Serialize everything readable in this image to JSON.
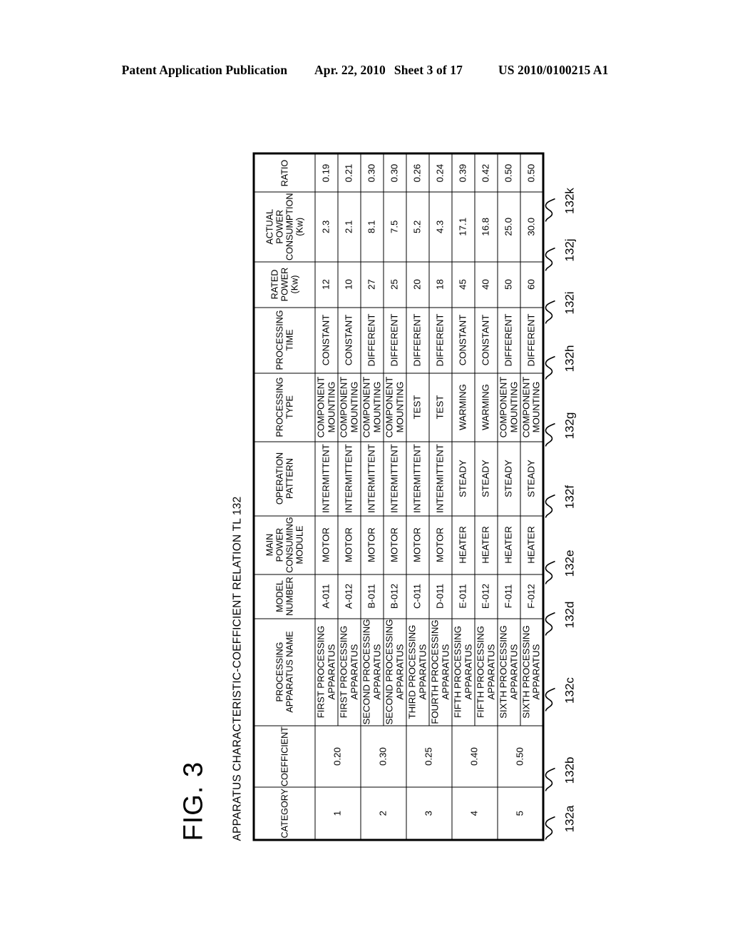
{
  "header": {
    "publication": "Patent Application Publication",
    "date": "Apr. 22, 2010",
    "sheet": "Sheet 3 of 17",
    "patent_number": "US 2010/0100215 A1"
  },
  "figure": {
    "label": "FIG. 3",
    "caption": "APPARATUS CHARACTERISTIC-COEFFICIENT RELATION TL 132"
  },
  "table": {
    "columns": [
      {
        "ref": "132a",
        "header": "CATEGORY"
      },
      {
        "ref": "132b",
        "header": "COEFFICIENT"
      },
      {
        "ref": "132c",
        "header": "PROCESSING APPARATUS NAME"
      },
      {
        "ref": "132d",
        "header": "MODEL NUMBER"
      },
      {
        "ref": "132e",
        "header": "MAIN POWER CONSUMING MODULE"
      },
      {
        "ref": "132f",
        "header": "OPERATION PATTERN"
      },
      {
        "ref": "132g",
        "header": "PROCESSING TYPE"
      },
      {
        "ref": "132h",
        "header": "PROCESSING TIME"
      },
      {
        "ref": "132i",
        "header": "RATED POWER (Kw)"
      },
      {
        "ref": "132j",
        "header": "ACTUAL POWER CONSUMPTION (Kw)"
      },
      {
        "ref": "132k",
        "header": "RATIO"
      }
    ],
    "headers": {
      "category": "CATEGORY",
      "coefficient": "COEFFICIENT",
      "apparatus_name": "PROCESSING APPARATUS NAME",
      "model_number": "MODEL NUMBER",
      "module": "MAIN POWER CONSUMING MODULE",
      "operation_pattern": "OPERATION PATTERN",
      "processing_type": "PROCESSING TYPE",
      "processing_time": "PROCESSING TIME",
      "rated_power": "RATED POWER (Kw)",
      "actual_power": "ACTUAL POWER CONSUMPTION (Kw)",
      "ratio": "RATIO"
    },
    "groups": [
      {
        "category": "1",
        "coefficient": "0.20",
        "rows": [
          {
            "name": "FIRST PROCESSING APPARATUS",
            "model": "A-011",
            "module": "MOTOR",
            "pattern": "INTERMITTENT",
            "type": "COMPONENT MOUNTING",
            "time": "CONSTANT",
            "rated": "12",
            "actual": "2.3",
            "ratio": "0.19"
          },
          {
            "name": "FIRST PROCESSING APPARATUS",
            "model": "A-012",
            "module": "MOTOR",
            "pattern": "INTERMITTENT",
            "type": "COMPONENT MOUNTING",
            "time": "CONSTANT",
            "rated": "10",
            "actual": "2.1",
            "ratio": "0.21"
          }
        ]
      },
      {
        "category": "2",
        "coefficient": "0.30",
        "rows": [
          {
            "name": "SECOND PROCESSING APPARATUS",
            "model": "B-011",
            "module": "MOTOR",
            "pattern": "INTERMITTENT",
            "type": "COMPONENT MOUNTING",
            "time": "DIFFERENT",
            "rated": "27",
            "actual": "8.1",
            "ratio": "0.30"
          },
          {
            "name": "SECOND PROCESSING APPARATUS",
            "model": "B-012",
            "module": "MOTOR",
            "pattern": "INTERMITTENT",
            "type": "COMPONENT MOUNTING",
            "time": "DIFFERENT",
            "rated": "25",
            "actual": "7.5",
            "ratio": "0.30"
          }
        ]
      },
      {
        "category": "3",
        "coefficient": "0.25",
        "rows": [
          {
            "name": "THIRD PROCESSING APPARATUS",
            "model": "C-011",
            "module": "MOTOR",
            "pattern": "INTERMITTENT",
            "type": "TEST",
            "time": "DIFFERENT",
            "rated": "20",
            "actual": "5.2",
            "ratio": "0.26"
          },
          {
            "name": "FOURTH PROCESSING APPARATUS",
            "model": "D-011",
            "module": "MOTOR",
            "pattern": "INTERMITTENT",
            "type": "TEST",
            "time": "DIFFERENT",
            "rated": "18",
            "actual": "4.3",
            "ratio": "0.24"
          }
        ]
      },
      {
        "category": "4",
        "coefficient": "0.40",
        "rows": [
          {
            "name": "FIFTH PROCESSING APPARATUS",
            "model": "E-011",
            "module": "HEATER",
            "pattern": "STEADY",
            "type": "WARMING",
            "time": "CONSTANT",
            "rated": "45",
            "actual": "17.1",
            "ratio": "0.39"
          },
          {
            "name": "FIFTH PROCESSING APPARATUS",
            "model": "E-012",
            "module": "HEATER",
            "pattern": "STEADY",
            "type": "WARMING",
            "time": "CONSTANT",
            "rated": "40",
            "actual": "16.8",
            "ratio": "0.42"
          }
        ]
      },
      {
        "category": "5",
        "coefficient": "0.50",
        "rows": [
          {
            "name": "SIXTH PROCESSING APPARATUS",
            "model": "F-011",
            "module": "HEATER",
            "pattern": "STEADY",
            "type": "COMPONENT MOUNTING",
            "time": "DIFFERENT",
            "rated": "50",
            "actual": "25.0",
            "ratio": "0.50"
          },
          {
            "name": "SIXTH PROCESSING APPARATUS",
            "model": "F-012",
            "module": "HEATER",
            "pattern": "STEADY",
            "type": "COMPONENT MOUNTING",
            "time": "DIFFERENT",
            "rated": "60",
            "actual": "30.0",
            "ratio": "0.50"
          }
        ]
      }
    ]
  }
}
